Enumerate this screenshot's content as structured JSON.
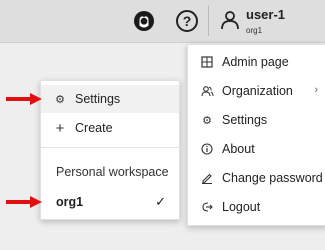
{
  "header": {
    "user_name": "user-1",
    "user_org": "org1"
  },
  "user_menu": {
    "items": [
      {
        "label": "Admin page",
        "icon": "grid-icon"
      },
      {
        "label": "Organization",
        "icon": "people-icon",
        "has_submenu": true
      },
      {
        "label": "Settings",
        "icon": "gear-icon"
      },
      {
        "label": "About",
        "icon": "info-icon"
      },
      {
        "label": "Change password",
        "icon": "pen-icon"
      },
      {
        "label": "Logout",
        "icon": "logout-icon"
      }
    ]
  },
  "workspace_menu": {
    "settings_label": "Settings",
    "create_label": "Create",
    "section_title": "Personal workspace",
    "org_name": "org1",
    "check": "✓"
  },
  "colors": {
    "arrow": "#e01010"
  }
}
